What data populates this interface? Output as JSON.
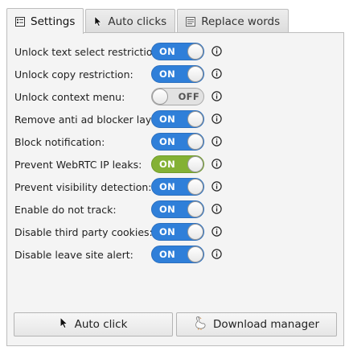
{
  "tabs": [
    {
      "label": "Settings",
      "icon": "settings-list-icon",
      "active": true
    },
    {
      "label": "Auto clicks",
      "icon": "cursor-icon",
      "active": false
    },
    {
      "label": "Replace words",
      "icon": "document-icon",
      "active": false
    }
  ],
  "settings": [
    {
      "label": "Unlock text select restriction:",
      "state": "ON"
    },
    {
      "label": "Unlock copy restriction:",
      "state": "ON"
    },
    {
      "label": "Unlock context menu:",
      "state": "OFF"
    },
    {
      "label": "Remove anti ad blocker layer:",
      "state": "ON"
    },
    {
      "label": "Block notification:",
      "state": "ON"
    },
    {
      "label": "Prevent WebRTC IP leaks:",
      "state": "ON"
    },
    {
      "label": "Prevent visibility detection:",
      "state": "ON"
    },
    {
      "label": "Enable do not track:",
      "state": "ON"
    },
    {
      "label": "Disable third party cookies:",
      "state": "ON"
    },
    {
      "label": "Disable leave site alert:",
      "state": "ON"
    }
  ],
  "colors": {
    "toggle_on": "#2f7fd9",
    "toggle_on_highlight": "#84b135",
    "toggle_off": "#e2e2e2"
  },
  "buttons": {
    "auto_click": {
      "label": "Auto click",
      "icon": "cursor-icon"
    },
    "download_manager": {
      "label": "Download manager",
      "icon": "goose-icon"
    }
  }
}
